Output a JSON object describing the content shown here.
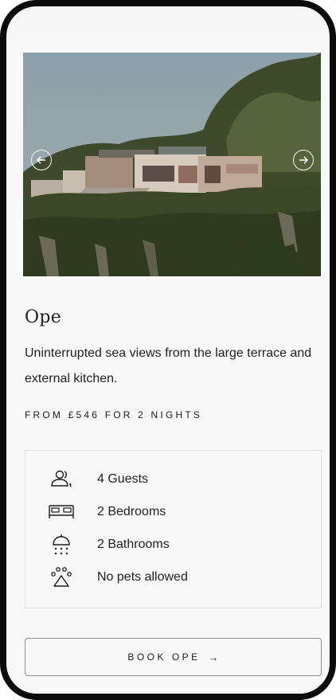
{
  "property": {
    "name": "Ope",
    "description": "Uninterrupted sea views from the large terrace and external kitchen.",
    "price": "FROM £546 FOR 2 NIGHTS"
  },
  "gallery": {
    "prev_icon": "arrow-left-icon",
    "next_icon": "arrow-right-icon"
  },
  "features": [
    {
      "icon": "guests-icon",
      "label": "4 Guests"
    },
    {
      "icon": "bed-icon",
      "label": "2 Bedrooms"
    },
    {
      "icon": "shower-icon",
      "label": "2 Bathrooms"
    },
    {
      "icon": "paw-icon",
      "label": "No pets allowed"
    }
  ],
  "cta": {
    "label": "BOOK OPE",
    "arrow": "→"
  }
}
